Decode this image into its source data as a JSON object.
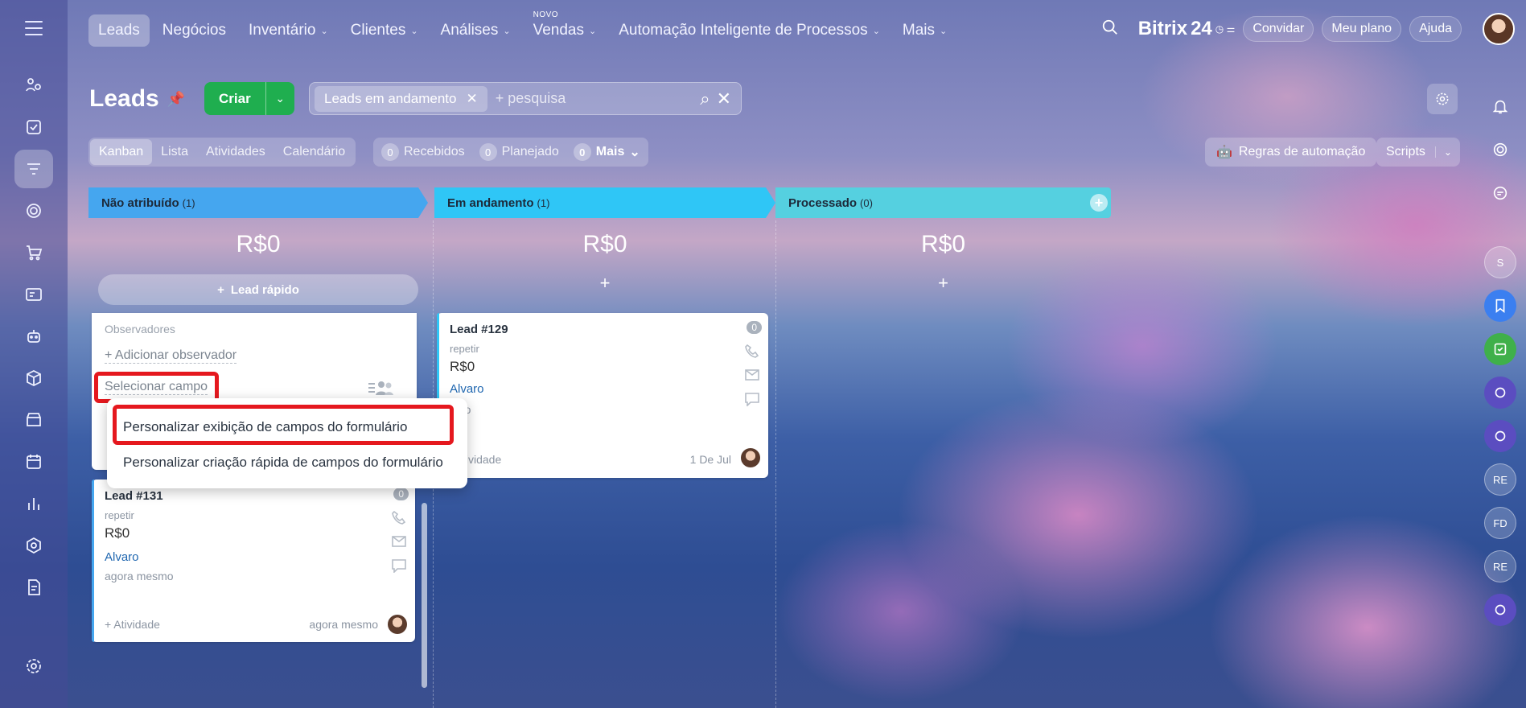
{
  "nav": {
    "items": [
      {
        "label": "Leads",
        "active": true,
        "chevron": false,
        "badge": ""
      },
      {
        "label": "Negócios",
        "active": false,
        "chevron": false,
        "badge": ""
      },
      {
        "label": "Inventário",
        "active": false,
        "chevron": true,
        "badge": ""
      },
      {
        "label": "Clientes",
        "active": false,
        "chevron": true,
        "badge": ""
      },
      {
        "label": "Análises",
        "active": false,
        "chevron": true,
        "badge": ""
      },
      {
        "label": "Vendas",
        "active": false,
        "chevron": true,
        "badge": "NOVO"
      },
      {
        "label": "Automação Inteligente de Processos",
        "active": false,
        "chevron": true,
        "badge": ""
      },
      {
        "label": "Mais",
        "active": false,
        "chevron": true,
        "badge": ""
      }
    ],
    "brand": "Bitrix",
    "brand_num": "24",
    "invite": "Convidar",
    "my_plan": "Meu plano",
    "help": "Ajuda"
  },
  "page": {
    "title": "Leads",
    "create": "Criar",
    "filter_chip": "Leads em andamento",
    "search_placeholder": "+ pesquisa"
  },
  "view_tabs": [
    {
      "label": "Kanban",
      "active": true
    },
    {
      "label": "Lista",
      "active": false
    },
    {
      "label": "Atividades",
      "active": false
    },
    {
      "label": "Calendário",
      "active": false
    }
  ],
  "counters": [
    {
      "num": "0",
      "label": "Recebidos"
    },
    {
      "num": "0",
      "label": "Planejado"
    },
    {
      "num": "0",
      "label": "Mais"
    }
  ],
  "toolbar": {
    "automation": "Regras de automação",
    "scripts": "Scripts"
  },
  "columns": [
    {
      "title": "Não atribuído",
      "count": "(1)",
      "total": "R$0",
      "quick": "Lead rápido",
      "color": "#45a6ef"
    },
    {
      "title": "Em andamento",
      "count": "(1)",
      "total": "R$0",
      "quick": "+",
      "color": "#2fc6f6"
    },
    {
      "title": "Processado",
      "count": "(0)",
      "total": "R$0",
      "quick": "+",
      "color": "#55d0e0"
    }
  ],
  "popup_card": {
    "observers": "Observadores",
    "add_observer": "+ Adicionar observador",
    "select_field": "Selecionar campo"
  },
  "menu": {
    "item1": "Personalizar exibição de campos do formulário",
    "item2": "Personalizar criação rápida de campos do formulário"
  },
  "cards": {
    "lead131": {
      "title": "Lead #131",
      "badge": "0",
      "sub": "repetir",
      "amount": "R$0",
      "person": "Alvaro",
      "time": "agora mesmo",
      "activity": "+ Atividade",
      "date": "agora mesmo"
    },
    "lead129": {
      "title": "Lead #129",
      "badge": "0",
      "sub": "repetir",
      "amount": "R$0",
      "person": "Alvaro",
      "time": "ulho",
      "activity": "tividade",
      "date": "1 De Jul"
    }
  },
  "rightbar": [
    "S",
    "RE",
    "FD",
    "RE"
  ],
  "colors": {
    "accent_green": "#1fae4f",
    "highlight_red": "#e5181e",
    "link_blue": "#2067b0"
  }
}
